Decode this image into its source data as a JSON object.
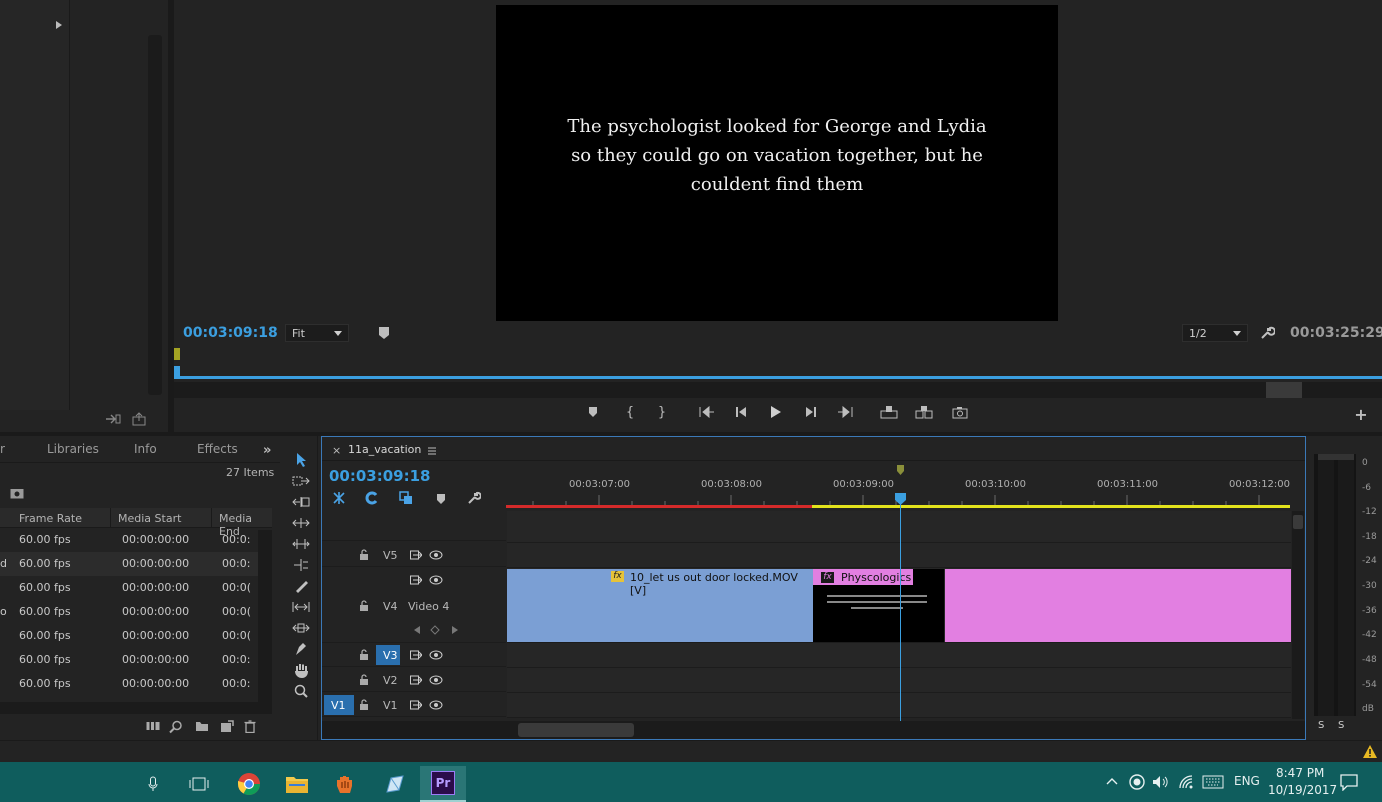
{
  "program_monitor": {
    "caption": "The psychologist looked for George and Lydia so they could go on vacation together, but he couldent find them",
    "current_time": "00:03:09:18",
    "fit_label": "Fit",
    "resolution_label": "1/2",
    "duration": "00:03:25:29"
  },
  "project_panel": {
    "tabs": [
      "r",
      "Libraries",
      "Info",
      "Effects"
    ],
    "items_count": "27 Items",
    "columns": [
      "Frame Rate",
      "Media Start",
      "Media End"
    ],
    "rows": [
      {
        "frame_rate": "60.00 fps",
        "media_start": "00:00:00:00",
        "media_end": "00:0:"
      },
      {
        "frame_rate": "60.00 fps",
        "media_start": "00:00:00:00",
        "media_end": "00:0:"
      },
      {
        "frame_rate": "60.00 fps",
        "media_start": "00:00:00:00",
        "media_end": "00:0("
      },
      {
        "frame_rate": "60.00 fps",
        "media_start": "00:00:00:00",
        "media_end": "00:0("
      },
      {
        "frame_rate": "60.00 fps",
        "media_start": "00:00:00:00",
        "media_end": "00:0("
      },
      {
        "frame_rate": "60.00 fps",
        "media_start": "00:00:00:00",
        "media_end": "00:0:"
      },
      {
        "frame_rate": "60.00 fps",
        "media_start": "00:00:00:00",
        "media_end": "00:0:"
      }
    ],
    "row_prefixes": [
      "",
      "d",
      "",
      "o",
      "",
      "",
      ""
    ]
  },
  "timeline": {
    "sequence_name": "11a_vacation",
    "current_time": "00:03:09:18",
    "ruler_labels": [
      "00:03:07:00",
      "00:03:08:00",
      "00:03:09:00",
      "00:03:10:00",
      "00:03:11:00",
      "00:03:12:00"
    ],
    "tracks": {
      "v5": "V5",
      "v4": "V4",
      "v4_name": "Video 4",
      "v3": "V3",
      "v2": "V2",
      "v1": "V1",
      "v1_source": "V1"
    },
    "clips": {
      "clip1": "10_let us out door locked.MOV [V]",
      "clip2": "Physcologics"
    },
    "fx": "fx"
  },
  "meter": {
    "db_labels": [
      "0",
      "-6",
      "-12",
      "-18",
      "-24",
      "-30",
      "-36",
      "-42",
      "-48",
      "-54",
      "dB"
    ],
    "solo_labels": [
      "S",
      "S"
    ]
  },
  "taskbar": {
    "language": "ENG",
    "time": "8:47 PM",
    "date": "10/19/2017",
    "premiere_label": "Pr"
  },
  "colors": {
    "accent_blue": "#3b9fe0",
    "clip_blue": "#7b9fd4",
    "clip_pink": "#e27fe1",
    "taskbar": "#0f5d5d"
  }
}
